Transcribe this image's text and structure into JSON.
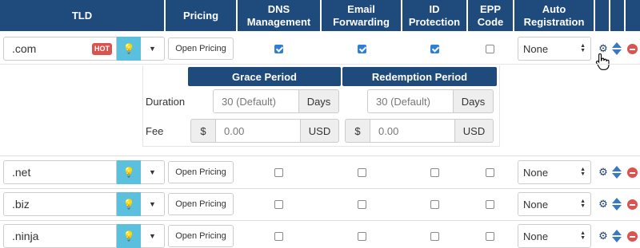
{
  "header": {
    "tld": "TLD",
    "pricing": "Pricing",
    "dns_line1": "DNS",
    "dns_line2": "Management",
    "email_line1": "Email",
    "email_line2": "Forwarding",
    "id_line1": "ID",
    "id_line2": "Protection",
    "epp_line1": "EPP",
    "epp_line2": "Code",
    "auto_line1": "Auto",
    "auto_line2": "Registration"
  },
  "rows": [
    {
      "tld": ".com",
      "badge": "HOT",
      "pricing_button": "Open Pricing",
      "dns": true,
      "email": true,
      "id_protection": true,
      "epp": false,
      "auto_registration": "None"
    },
    {
      "tld": ".net",
      "badge": "",
      "pricing_button": "Open Pricing",
      "dns": false,
      "email": false,
      "id_protection": false,
      "epp": false,
      "auto_registration": "None"
    },
    {
      "tld": ".biz",
      "badge": "",
      "pricing_button": "Open Pricing",
      "dns": false,
      "email": false,
      "id_protection": false,
      "epp": false,
      "auto_registration": "None"
    },
    {
      "tld": ".ninja",
      "badge": "",
      "pricing_button": "Open Pricing",
      "dns": false,
      "email": false,
      "id_protection": false,
      "epp": false,
      "auto_registration": "None"
    }
  ],
  "expanded": {
    "grace_period_title": "Grace Period",
    "redemption_period_title": "Redemption Period",
    "duration_label": "Duration",
    "fee_label": "Fee",
    "grace_duration_placeholder": "30 (Default)",
    "grace_duration_unit": "Days",
    "redemption_duration_placeholder": "30 (Default)",
    "redemption_duration_unit": "Days",
    "currency_symbol": "$",
    "grace_fee_value": "0.00",
    "grace_fee_currency": "USD",
    "redemption_fee_value": "0.00",
    "redemption_fee_currency": "USD"
  },
  "colors": {
    "header_bg": "#1f4a7c",
    "hot_badge": "#d9534f",
    "bulb_button": "#5bc0de",
    "checkbox_checked": "#2f7fd6"
  },
  "icons": {
    "bulb": "lightbulb-icon",
    "caret": "caret-down-icon",
    "settings": "gear-icon",
    "sort": "sort-arrows-icon",
    "remove": "remove-circle-icon",
    "pointer": "hand-pointer-icon"
  }
}
